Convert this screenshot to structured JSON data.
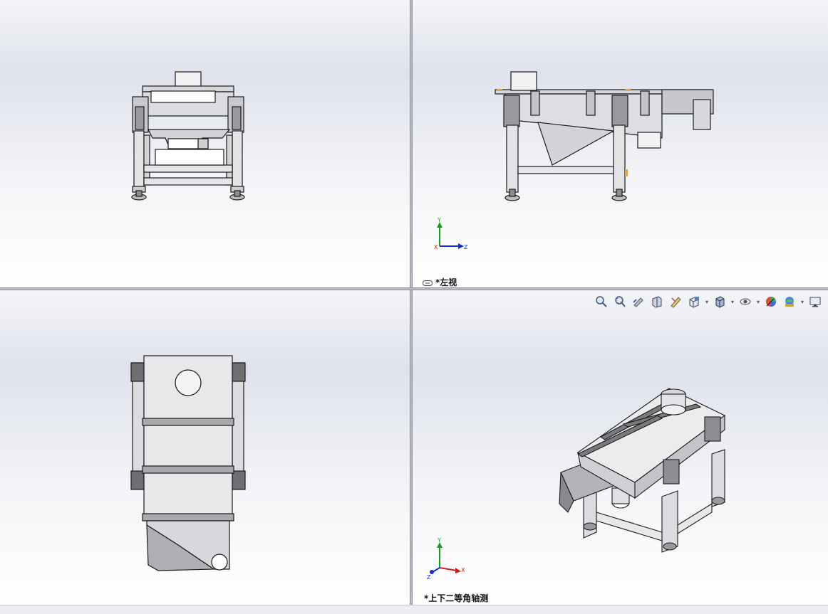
{
  "viewports": {
    "front": {
      "label": ""
    },
    "left": {
      "label": "*左视"
    },
    "top": {
      "label": ""
    },
    "iso": {
      "label": "*上下二等角轴测"
    }
  },
  "triad": {
    "y": "Y",
    "z": "Z",
    "x": "X"
  },
  "toolbar": {
    "icons": [
      "zoom-to-fit-icon",
      "zoom-to-area-icon",
      "previous-view-icon",
      "section-view-icon",
      "dynamic-annotation-icon",
      "view-orientation-icon",
      "display-style-icon",
      "hide-show-items-icon",
      "edit-appearance-icon",
      "apply-scene-icon",
      "view-settings-icon"
    ]
  },
  "colors": {
    "steel": "#e6e6e8",
    "outline": "#1a1a1a",
    "accent_orange": "#e8a040",
    "triad_green": "#1a9a1a",
    "triad_blue": "#1a2ad0",
    "triad_red": "#d01a1a"
  }
}
